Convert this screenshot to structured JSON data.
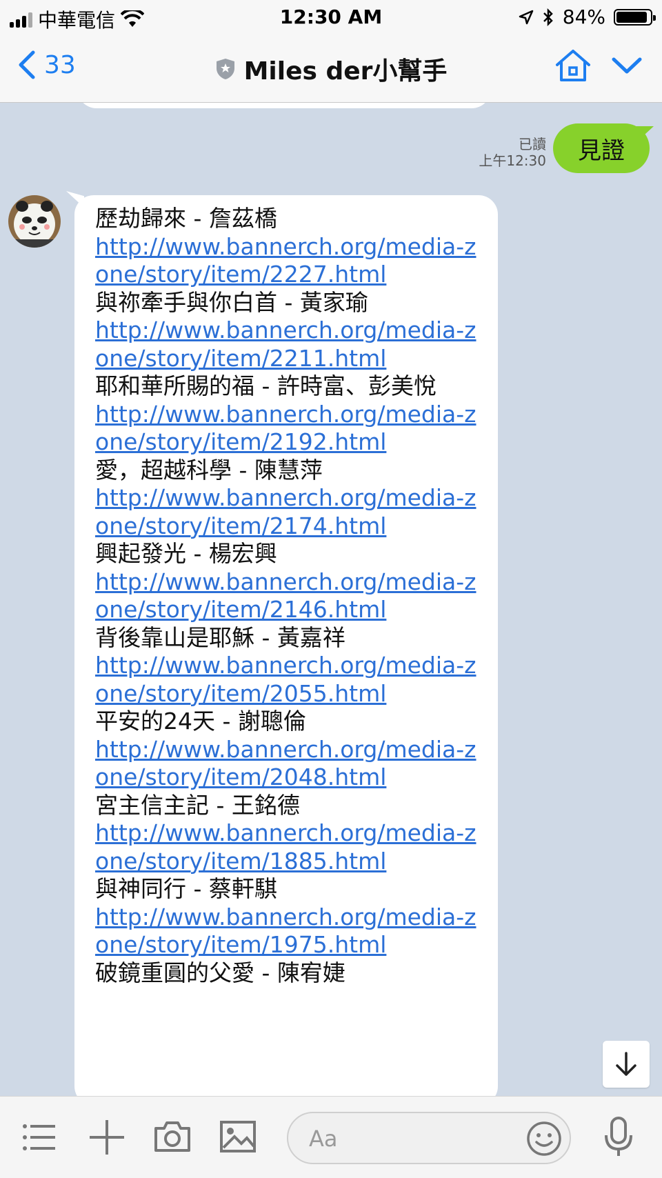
{
  "status_bar": {
    "carrier": "中華電信",
    "time": "12:30 AM",
    "battery": "84%"
  },
  "nav": {
    "back_count": "33",
    "title": "Miles der小幫手"
  },
  "outgoing": {
    "read_label": "已讀",
    "time": "上午12:30",
    "text": "見證"
  },
  "incoming": {
    "items": [
      {
        "title": "歷劫歸來 - 詹茲橋",
        "url": "http://www.bannerch.org/media-zone/story/item/2227.html"
      },
      {
        "title": "與祢牽手與你白首 - 黃家瑜",
        "url": "http://www.bannerch.org/media-zone/story/item/2211.html"
      },
      {
        "title": "耶和華所賜的福 - 許時富、彭美悅",
        "url": "http://www.bannerch.org/media-zone/story/item/2192.html"
      },
      {
        "title": "愛，超越科學  - 陳慧萍",
        "url": "http://www.bannerch.org/media-zone/story/item/2174.html"
      },
      {
        "title": "興起發光 - 楊宏興",
        "url": "http://www.bannerch.org/media-zone/story/item/2146.html"
      },
      {
        "title": "背後靠山是耶穌 - 黃嘉祥",
        "url": "http://www.bannerch.org/media-zone/story/item/2055.html"
      },
      {
        "title": "平安的24天 - 謝聰倫",
        "url": "http://www.bannerch.org/media-zone/story/item/2048.html"
      },
      {
        "title": "宮主信主記 - 王銘德",
        "url": "http://www.bannerch.org/media-zone/story/item/1885.html"
      },
      {
        "title": "與神同行 - 蔡軒騏",
        "url": "http://www.bannerch.org/media-zone/story/item/1975.html"
      },
      {
        "title": "破鏡重圓的父愛 - 陳宥婕",
        "url": ""
      }
    ]
  },
  "composer": {
    "placeholder": "Aa"
  },
  "colors": {
    "chat_bg": "#cfd9e6",
    "outgoing_bubble": "#87d12b",
    "link": "#2b6fd6",
    "nav_accent": "#1d7ef0"
  }
}
